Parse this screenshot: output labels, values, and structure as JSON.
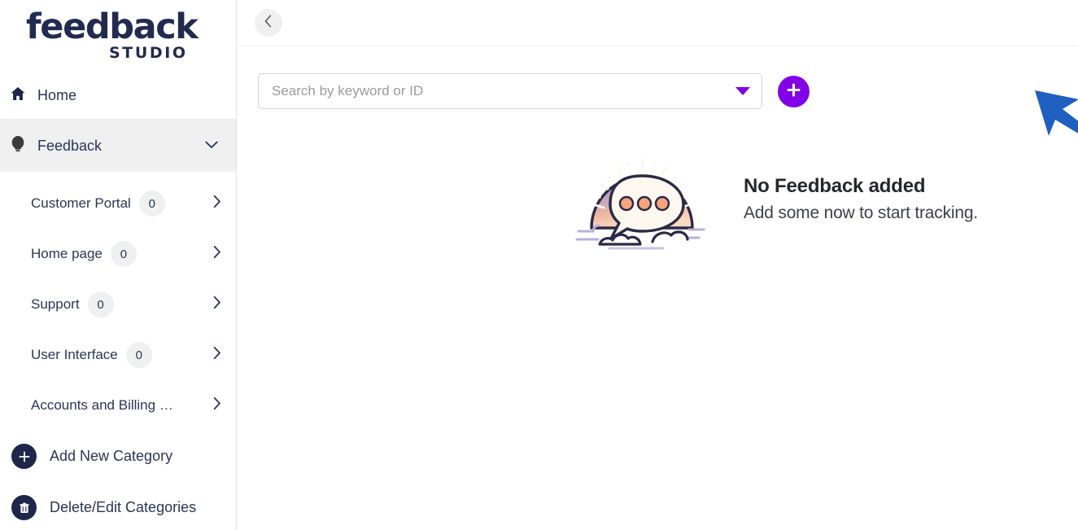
{
  "brand": {
    "logo_main": "feedback",
    "logo_sub": "STUDIO",
    "logo_color": "#222b4f",
    "accent_color": "#8100e8",
    "annotation_color": "#1f5fbf"
  },
  "sidebar": {
    "home": {
      "label": "Home",
      "icon": "home-icon"
    },
    "feedback": {
      "label": "Feedback",
      "icon": "lightbulb-icon",
      "expanded": true,
      "chevron": "chevron-down-icon"
    },
    "categories": [
      {
        "label": "Customer Portal",
        "count": "0",
        "chevron": "chevron-right-icon"
      },
      {
        "label": "Home page",
        "count": "0",
        "chevron": "chevron-right-icon"
      },
      {
        "label": "Support",
        "count": "0",
        "chevron": "chevron-right-icon"
      },
      {
        "label": "User Interface",
        "count": "0",
        "chevron": "chevron-right-icon"
      },
      {
        "label": "Accounts and Billing …",
        "count": "",
        "chevron": "chevron-right-icon"
      }
    ],
    "actions": [
      {
        "label": "Add New Category",
        "icon": "plus-icon"
      },
      {
        "label": "Delete/Edit Categories",
        "icon": "trash-icon"
      }
    ]
  },
  "topbar": {
    "back_button_icon": "chevron-left-icon"
  },
  "search": {
    "placeholder": "Search by keyword or ID",
    "value": "",
    "dropdown_icon": "caret-down-icon",
    "add_button_icon": "plus-icon"
  },
  "empty_state": {
    "title": "No Feedback added",
    "subtitle": "Add some now to start tracking.",
    "illustration": "speech-bubble-dome-illustration"
  }
}
